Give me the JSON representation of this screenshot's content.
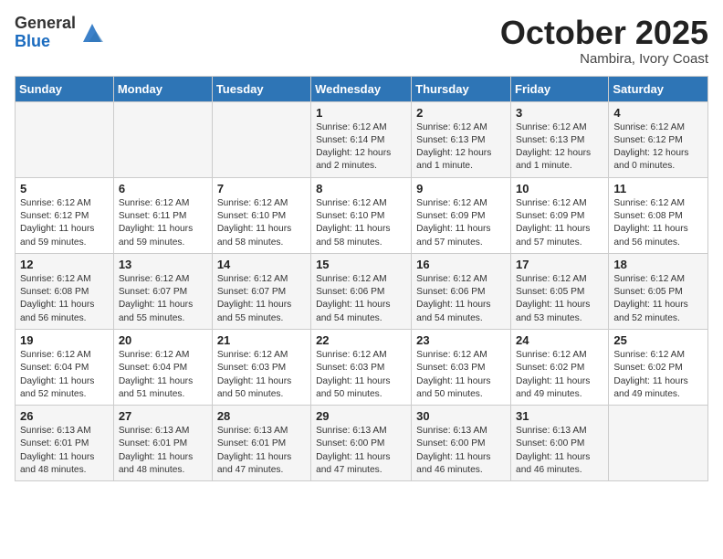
{
  "header": {
    "logo_general": "General",
    "logo_blue": "Blue",
    "month": "October 2025",
    "location": "Nambira, Ivory Coast"
  },
  "weekdays": [
    "Sunday",
    "Monday",
    "Tuesday",
    "Wednesday",
    "Thursday",
    "Friday",
    "Saturday"
  ],
  "weeks": [
    [
      null,
      null,
      null,
      {
        "day": "1",
        "sunrise": "Sunrise: 6:12 AM",
        "sunset": "Sunset: 6:14 PM",
        "daylight": "Daylight: 12 hours and 2 minutes."
      },
      {
        "day": "2",
        "sunrise": "Sunrise: 6:12 AM",
        "sunset": "Sunset: 6:13 PM",
        "daylight": "Daylight: 12 hours and 1 minute."
      },
      {
        "day": "3",
        "sunrise": "Sunrise: 6:12 AM",
        "sunset": "Sunset: 6:13 PM",
        "daylight": "Daylight: 12 hours and 1 minute."
      },
      {
        "day": "4",
        "sunrise": "Sunrise: 6:12 AM",
        "sunset": "Sunset: 6:12 PM",
        "daylight": "Daylight: 12 hours and 0 minutes."
      }
    ],
    [
      {
        "day": "5",
        "sunrise": "Sunrise: 6:12 AM",
        "sunset": "Sunset: 6:12 PM",
        "daylight": "Daylight: 11 hours and 59 minutes."
      },
      {
        "day": "6",
        "sunrise": "Sunrise: 6:12 AM",
        "sunset": "Sunset: 6:11 PM",
        "daylight": "Daylight: 11 hours and 59 minutes."
      },
      {
        "day": "7",
        "sunrise": "Sunrise: 6:12 AM",
        "sunset": "Sunset: 6:10 PM",
        "daylight": "Daylight: 11 hours and 58 minutes."
      },
      {
        "day": "8",
        "sunrise": "Sunrise: 6:12 AM",
        "sunset": "Sunset: 6:10 PM",
        "daylight": "Daylight: 11 hours and 58 minutes."
      },
      {
        "day": "9",
        "sunrise": "Sunrise: 6:12 AM",
        "sunset": "Sunset: 6:09 PM",
        "daylight": "Daylight: 11 hours and 57 minutes."
      },
      {
        "day": "10",
        "sunrise": "Sunrise: 6:12 AM",
        "sunset": "Sunset: 6:09 PM",
        "daylight": "Daylight: 11 hours and 57 minutes."
      },
      {
        "day": "11",
        "sunrise": "Sunrise: 6:12 AM",
        "sunset": "Sunset: 6:08 PM",
        "daylight": "Daylight: 11 hours and 56 minutes."
      }
    ],
    [
      {
        "day": "12",
        "sunrise": "Sunrise: 6:12 AM",
        "sunset": "Sunset: 6:08 PM",
        "daylight": "Daylight: 11 hours and 56 minutes."
      },
      {
        "day": "13",
        "sunrise": "Sunrise: 6:12 AM",
        "sunset": "Sunset: 6:07 PM",
        "daylight": "Daylight: 11 hours and 55 minutes."
      },
      {
        "day": "14",
        "sunrise": "Sunrise: 6:12 AM",
        "sunset": "Sunset: 6:07 PM",
        "daylight": "Daylight: 11 hours and 55 minutes."
      },
      {
        "day": "15",
        "sunrise": "Sunrise: 6:12 AM",
        "sunset": "Sunset: 6:06 PM",
        "daylight": "Daylight: 11 hours and 54 minutes."
      },
      {
        "day": "16",
        "sunrise": "Sunrise: 6:12 AM",
        "sunset": "Sunset: 6:06 PM",
        "daylight": "Daylight: 11 hours and 54 minutes."
      },
      {
        "day": "17",
        "sunrise": "Sunrise: 6:12 AM",
        "sunset": "Sunset: 6:05 PM",
        "daylight": "Daylight: 11 hours and 53 minutes."
      },
      {
        "day": "18",
        "sunrise": "Sunrise: 6:12 AM",
        "sunset": "Sunset: 6:05 PM",
        "daylight": "Daylight: 11 hours and 52 minutes."
      }
    ],
    [
      {
        "day": "19",
        "sunrise": "Sunrise: 6:12 AM",
        "sunset": "Sunset: 6:04 PM",
        "daylight": "Daylight: 11 hours and 52 minutes."
      },
      {
        "day": "20",
        "sunrise": "Sunrise: 6:12 AM",
        "sunset": "Sunset: 6:04 PM",
        "daylight": "Daylight: 11 hours and 51 minutes."
      },
      {
        "day": "21",
        "sunrise": "Sunrise: 6:12 AM",
        "sunset": "Sunset: 6:03 PM",
        "daylight": "Daylight: 11 hours and 50 minutes."
      },
      {
        "day": "22",
        "sunrise": "Sunrise: 6:12 AM",
        "sunset": "Sunset: 6:03 PM",
        "daylight": "Daylight: 11 hours and 50 minutes."
      },
      {
        "day": "23",
        "sunrise": "Sunrise: 6:12 AM",
        "sunset": "Sunset: 6:03 PM",
        "daylight": "Daylight: 11 hours and 50 minutes."
      },
      {
        "day": "24",
        "sunrise": "Sunrise: 6:12 AM",
        "sunset": "Sunset: 6:02 PM",
        "daylight": "Daylight: 11 hours and 49 minutes."
      },
      {
        "day": "25",
        "sunrise": "Sunrise: 6:12 AM",
        "sunset": "Sunset: 6:02 PM",
        "daylight": "Daylight: 11 hours and 49 minutes."
      }
    ],
    [
      {
        "day": "26",
        "sunrise": "Sunrise: 6:13 AM",
        "sunset": "Sunset: 6:01 PM",
        "daylight": "Daylight: 11 hours and 48 minutes."
      },
      {
        "day": "27",
        "sunrise": "Sunrise: 6:13 AM",
        "sunset": "Sunset: 6:01 PM",
        "daylight": "Daylight: 11 hours and 48 minutes."
      },
      {
        "day": "28",
        "sunrise": "Sunrise: 6:13 AM",
        "sunset": "Sunset: 6:01 PM",
        "daylight": "Daylight: 11 hours and 47 minutes."
      },
      {
        "day": "29",
        "sunrise": "Sunrise: 6:13 AM",
        "sunset": "Sunset: 6:00 PM",
        "daylight": "Daylight: 11 hours and 47 minutes."
      },
      {
        "day": "30",
        "sunrise": "Sunrise: 6:13 AM",
        "sunset": "Sunset: 6:00 PM",
        "daylight": "Daylight: 11 hours and 46 minutes."
      },
      {
        "day": "31",
        "sunrise": "Sunrise: 6:13 AM",
        "sunset": "Sunset: 6:00 PM",
        "daylight": "Daylight: 11 hours and 46 minutes."
      },
      null
    ]
  ]
}
